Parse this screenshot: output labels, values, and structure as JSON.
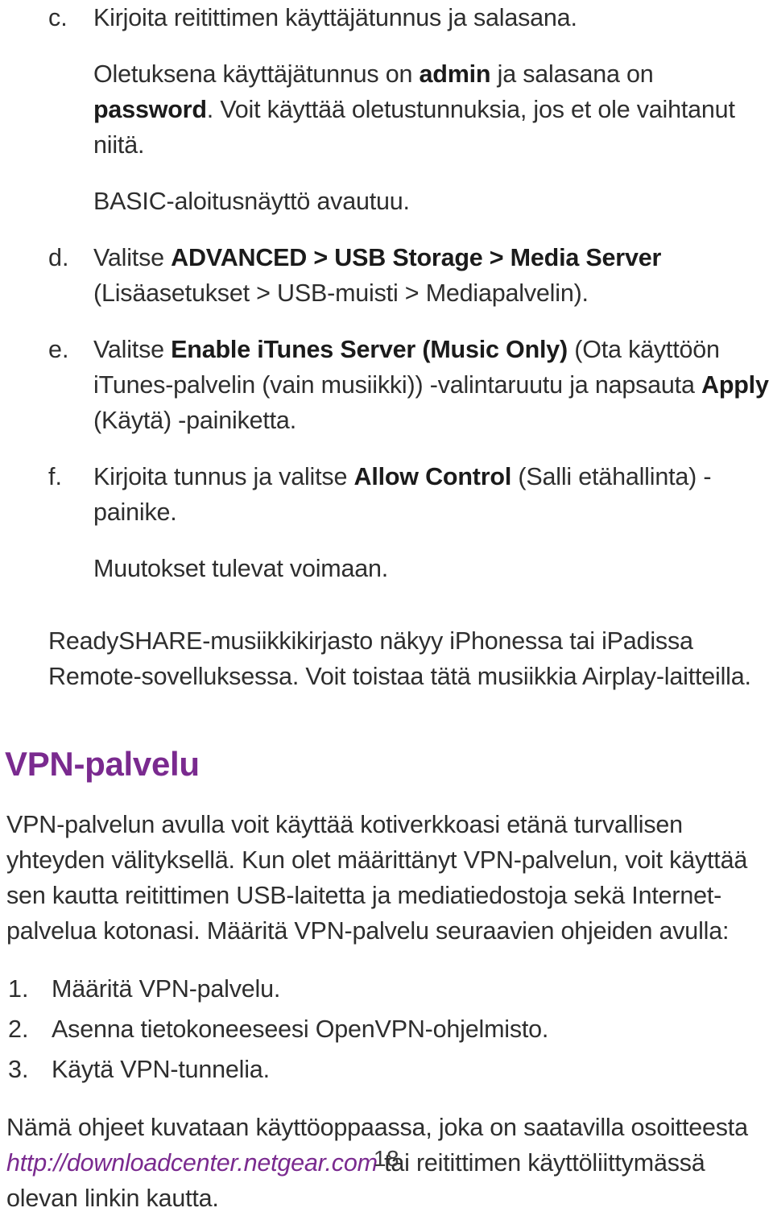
{
  "document": {
    "page_number": "18",
    "accent_color": "#7a2a8f",
    "text_color": "#2e2e2e"
  },
  "alpha_list": [
    {
      "marker": "c.",
      "paragraphs": [
        {
          "runs": [
            {
              "text": "Kirjoita reitittimen käyttäjätunnus ja salasana.",
              "style": "normal"
            }
          ]
        },
        {
          "runs": [
            {
              "text": "Oletuksena käyttäjätunnus on ",
              "style": "normal"
            },
            {
              "text": "admin",
              "style": "bold"
            },
            {
              "text": " ja salasana on ",
              "style": "normal"
            },
            {
              "text": "password",
              "style": "bold"
            },
            {
              "text": ". Voit käyttää oletustunnuksia, jos et ole vaihtanut niitä.",
              "style": "normal"
            }
          ]
        },
        {
          "runs": [
            {
              "text": "BASIC-aloitusnäyttö avautuu.",
              "style": "normal"
            }
          ]
        }
      ]
    },
    {
      "marker": "d.",
      "paragraphs": [
        {
          "runs": [
            {
              "text": "Valitse ",
              "style": "normal"
            },
            {
              "text": "ADVANCED > USB Storage > Media Server",
              "style": "bold"
            },
            {
              "text": " (Lisäasetukset > USB-muisti > Mediapalvelin).",
              "style": "normal"
            }
          ]
        }
      ]
    },
    {
      "marker": "e.",
      "paragraphs": [
        {
          "runs": [
            {
              "text": "Valitse ",
              "style": "normal"
            },
            {
              "text": "Enable iTunes Server (Music Only)",
              "style": "bold"
            },
            {
              "text": " (Ota käyttöön iTunes-palvelin (vain musiikki)) -valintaruutu ja napsauta ",
              "style": "normal"
            },
            {
              "text": "Apply",
              "style": "bold"
            },
            {
              "text": " (Käytä) -painiketta.",
              "style": "normal"
            }
          ]
        }
      ]
    },
    {
      "marker": "f.",
      "paragraphs": [
        {
          "runs": [
            {
              "text": "Kirjoita tunnus ja valitse ",
              "style": "normal"
            },
            {
              "text": "Allow Control",
              "style": "bold"
            },
            {
              "text": " (Salli etähallinta) -painike.",
              "style": "normal"
            }
          ]
        },
        {
          "runs": [
            {
              "text": "Muutokset tulevat voimaan.",
              "style": "normal"
            }
          ]
        }
      ]
    }
  ],
  "readyshare_note": {
    "runs": [
      {
        "text": "ReadySHARE-musiikkikirjasto näkyy iPhonessa tai iPadissa Remote-sovelluksessa. Voit toistaa tätä musiikkia Airplay-laitteilla.",
        "style": "normal"
      }
    ]
  },
  "vpn_section": {
    "heading": "VPN-palvelu",
    "intro": {
      "runs": [
        {
          "text": "VPN-palvelun avulla voit käyttää kotiverkkoasi etänä turvallisen yhteyden välityksellä. Kun olet määrittänyt VPN-palvelun, voit käyttää sen kautta reitittimen USB-laitetta ja mediatiedostoja sekä Internet-palvelua kotonasi. Määritä VPN-palvelu seuraavien ohjeiden avulla:",
          "style": "normal"
        }
      ]
    },
    "steps": [
      {
        "marker": "1.",
        "text": "Määritä VPN-palvelu."
      },
      {
        "marker": "2.",
        "text": "Asenna tietokoneeseesi OpenVPN-ohjelmisto."
      },
      {
        "marker": "3.",
        "text": "Käytä VPN-tunnelia."
      }
    ],
    "closing": {
      "prefix": "Nämä ohjeet kuvataan käyttöoppaassa, joka on saatavilla osoitteesta ",
      "link_text": "http://downloadcenter.netgear.com",
      "suffix": " tai reitittimen käyttöliittymässä olevan linkin kautta."
    }
  }
}
